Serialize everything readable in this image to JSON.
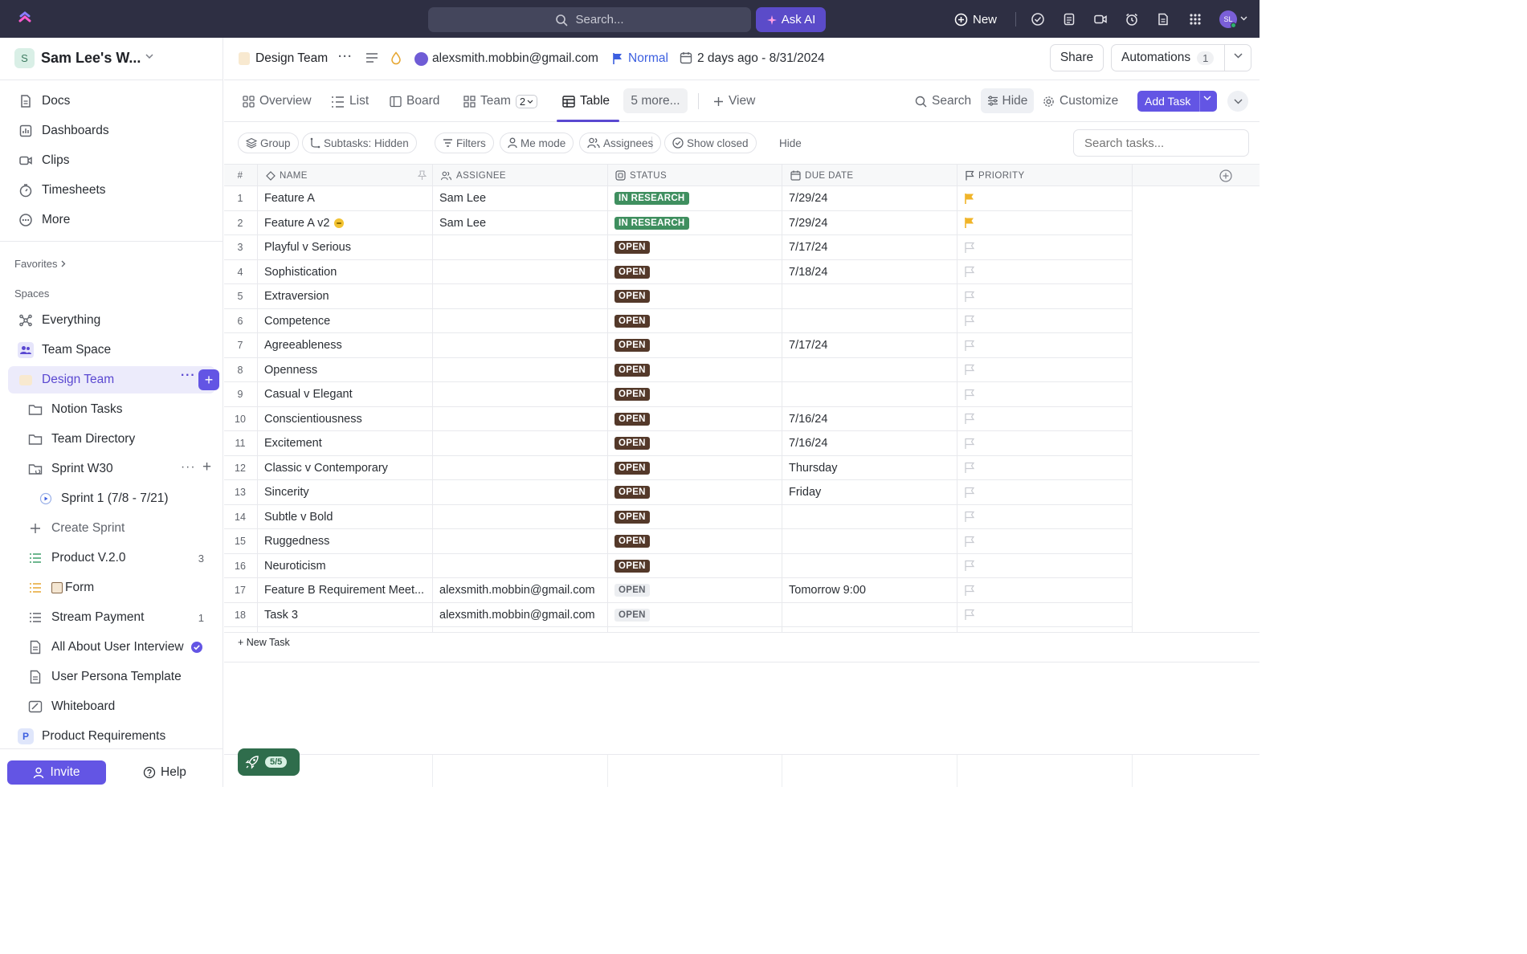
{
  "topbar": {
    "search_placeholder": "Search...",
    "ask_ai_label": "Ask AI",
    "new_label": "New",
    "avatar_initials": "SL",
    "icons": [
      "check-circle-icon",
      "notepad-icon",
      "video-icon",
      "alarm-icon",
      "document-icon",
      "apps-grid-icon"
    ]
  },
  "sidebar": {
    "workspace_initial": "S",
    "workspace_name": "Sam Lee's W...",
    "top_items": [
      {
        "label": "Docs",
        "icon": "doc-icon"
      },
      {
        "label": "Dashboards",
        "icon": "dashboard-icon"
      },
      {
        "label": "Clips",
        "icon": "video-icon"
      },
      {
        "label": "Timesheets",
        "icon": "timer-icon"
      },
      {
        "label": "More",
        "icon": "more-circle-icon"
      }
    ],
    "favorites_label": "Favorites",
    "spaces_label": "Spaces",
    "spaces": {
      "everything": "Everything",
      "team_space": "Team Space",
      "design_team": "Design Team",
      "notion_tasks": "Notion Tasks",
      "team_directory": "Team Directory",
      "sprint_w30": "Sprint W30",
      "sprint_1": "Sprint 1 (7/8 - 7/21)",
      "create_sprint": "Create Sprint",
      "product_v2": "Product V.2.0",
      "product_v2_count": "3",
      "form": "Form",
      "stream_payment": "Stream Payment",
      "stream_payment_count": "1",
      "all_about_user_interview": "All About User Interview",
      "user_persona_template": "User Persona Template",
      "whiteboard": "Whiteboard",
      "product_requirements_initial": "P",
      "product_requirements": "Product Requirements"
    },
    "invite_label": "Invite",
    "help_label": "Help"
  },
  "header": {
    "breadcrumb": "Design Team",
    "user_email": "alexsmith.mobbin@gmail.com",
    "priority": "Normal",
    "date_range": "2 days ago - 8/31/2024",
    "share_label": "Share",
    "automations_label": "Automations",
    "automations_count": "1"
  },
  "views": {
    "overview": "Overview",
    "list": "List",
    "board": "Board",
    "team": "Team",
    "team_count": "2",
    "table": "Table",
    "more": "5 more...",
    "add_view": "View",
    "search": "Search",
    "hide": "Hide",
    "customize": "Customize",
    "add_task": "Add Task"
  },
  "filters": {
    "group": "Group",
    "subtasks": "Subtasks: Hidden",
    "filters": "Filters",
    "me_mode": "Me mode",
    "assignees": "Assignees",
    "show_closed": "Show closed",
    "hide": "Hide",
    "search_placeholder": "Search tasks..."
  },
  "table": {
    "columns": {
      "num": "#",
      "name": "NAME",
      "assignee": "ASSIGNEE",
      "status": "STATUS",
      "due_date": "DUE DATE",
      "priority": "PRIORITY"
    },
    "rows": [
      {
        "n": "1",
        "name": "Feature A",
        "assignee": "Sam Lee",
        "status": "IN RESEARCH",
        "status_style": "research",
        "due": "7/29/24",
        "priority_flag": "yellow"
      },
      {
        "n": "2",
        "name": "Feature A v2",
        "assignee": "Sam Lee",
        "status": "IN RESEARCH",
        "status_style": "research",
        "due": "7/29/24",
        "priority_flag": "yellow",
        "has_emoji": true
      },
      {
        "n": "3",
        "name": "Playful v Serious",
        "assignee": "",
        "status": "OPEN",
        "status_style": "open-dark",
        "due": "7/17/24",
        "priority_flag": "empty"
      },
      {
        "n": "4",
        "name": "Sophistication",
        "assignee": "",
        "status": "OPEN",
        "status_style": "open-dark",
        "due": "7/18/24",
        "priority_flag": "empty"
      },
      {
        "n": "5",
        "name": "Extraversion",
        "assignee": "",
        "status": "OPEN",
        "status_style": "open-dark",
        "due": "",
        "priority_flag": "empty"
      },
      {
        "n": "6",
        "name": "Competence",
        "assignee": "",
        "status": "OPEN",
        "status_style": "open-dark",
        "due": "",
        "priority_flag": "empty"
      },
      {
        "n": "7",
        "name": "Agreeableness",
        "assignee": "",
        "status": "OPEN",
        "status_style": "open-dark",
        "due": "7/17/24",
        "priority_flag": "empty"
      },
      {
        "n": "8",
        "name": "Openness",
        "assignee": "",
        "status": "OPEN",
        "status_style": "open-dark",
        "due": "",
        "priority_flag": "empty"
      },
      {
        "n": "9",
        "name": "Casual v Elegant",
        "assignee": "",
        "status": "OPEN",
        "status_style": "open-dark",
        "due": "",
        "priority_flag": "empty"
      },
      {
        "n": "10",
        "name": "Conscientiousness",
        "assignee": "",
        "status": "OPEN",
        "status_style": "open-dark",
        "due": "7/16/24",
        "priority_flag": "empty"
      },
      {
        "n": "11",
        "name": "Excitement",
        "assignee": "",
        "status": "OPEN",
        "status_style": "open-dark",
        "due": "7/16/24",
        "priority_flag": "empty"
      },
      {
        "n": "12",
        "name": "Classic v Contemporary",
        "assignee": "",
        "status": "OPEN",
        "status_style": "open-dark",
        "due": "Thursday",
        "priority_flag": "empty"
      },
      {
        "n": "13",
        "name": "Sincerity",
        "assignee": "",
        "status": "OPEN",
        "status_style": "open-dark",
        "due": "Friday",
        "priority_flag": "empty"
      },
      {
        "n": "14",
        "name": "Subtle v Bold",
        "assignee": "",
        "status": "OPEN",
        "status_style": "open-dark",
        "due": "",
        "priority_flag": "empty"
      },
      {
        "n": "15",
        "name": "Ruggedness",
        "assignee": "",
        "status": "OPEN",
        "status_style": "open-dark",
        "due": "",
        "priority_flag": "empty"
      },
      {
        "n": "16",
        "name": "Neuroticism",
        "assignee": "",
        "status": "OPEN",
        "status_style": "open-dark",
        "due": "",
        "priority_flag": "empty"
      },
      {
        "n": "17",
        "name": "Feature B Requirement Meet...",
        "assignee": "alexsmith.mobbin@gmail.com",
        "status": "OPEN",
        "status_style": "open-light",
        "due": "Tomorrow 9:00",
        "priority_flag": "empty"
      },
      {
        "n": "18",
        "name": "Task 3",
        "assignee": "alexsmith.mobbin@gmail.com",
        "status": "OPEN",
        "status_style": "open-light",
        "due": "",
        "priority_flag": "empty"
      }
    ],
    "new_task_label": "+ New Task"
  },
  "footer": {
    "rocket_progress": "5/5"
  },
  "colors": {
    "accent": "#6355e4",
    "topbar": "#2e2f43",
    "status_research": "#3f8f5f",
    "status_open": "#54392a",
    "flag_yellow": "#f0b429"
  }
}
